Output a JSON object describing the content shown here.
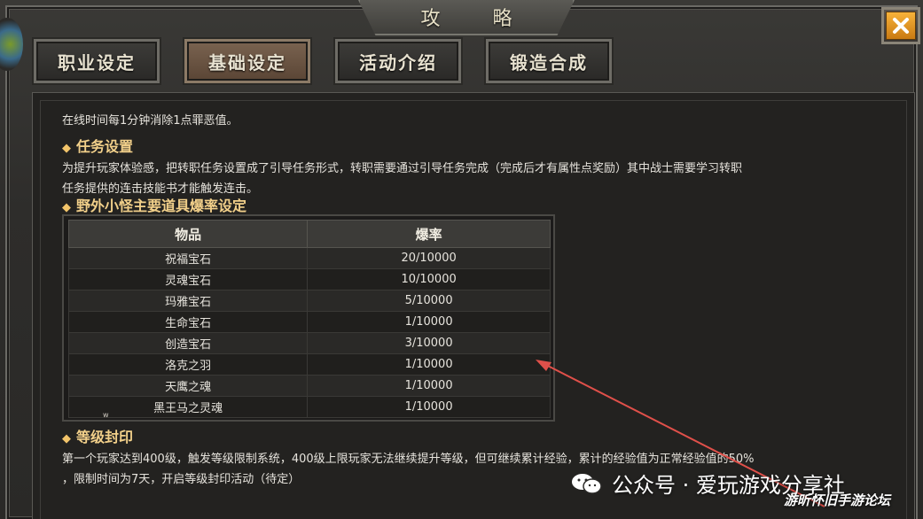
{
  "window": {
    "title": "攻  略",
    "close_icon": "close-icon"
  },
  "tabs": [
    {
      "label": "职业设定",
      "active": false
    },
    {
      "label": "基础设定",
      "active": true
    },
    {
      "label": "活动介绍",
      "active": false
    },
    {
      "label": "锻造合成",
      "active": false
    }
  ],
  "content": {
    "intro_line": "在线时间每1分钟消除1点罪恶值。",
    "task_heading": "任务设置",
    "task_line1": "为提升玩家体验感，把转职任务设置成了引导任务形式，转职需要通过引导任务完成（完成后才有属性点奖励）其中战士需要学习转职",
    "task_line2": "任务提供的连击技能书才能触发连击。",
    "drop_heading": "野外小怪主要道具爆率设定",
    "table": {
      "headers": [
        "物品",
        "爆率"
      ],
      "rows": [
        [
          "祝福宝石",
          "20/10000"
        ],
        [
          "灵魂宝石",
          "10/10000"
        ],
        [
          "玛雅宝石",
          "5/10000"
        ],
        [
          "生命宝石",
          "1/10000"
        ],
        [
          "创造宝石",
          "3/10000"
        ],
        [
          "洛克之羽",
          "1/10000"
        ],
        [
          "天鹰之魂",
          "1/10000"
        ],
        [
          "黑王马之灵魂",
          "1/10000"
        ]
      ]
    },
    "small_mark": "w",
    "seal_heading": "等级封印",
    "seal_line1": "第一个玩家达到400级，触发等级限制系统，400级上限玩家无法继续提升等级，但可继续累计经验，累计的经验值为正常经验值的50%",
    "seal_line2": "，限制时间为7天，开启等级封印活动（待定）"
  },
  "overlay": {
    "watermark": "公众号 · 爱玩游戏分享社",
    "watermark_icon": "wechat-icon",
    "watermark2": "游昕怀旧手游论坛",
    "annotation_color": "#e0504a"
  }
}
